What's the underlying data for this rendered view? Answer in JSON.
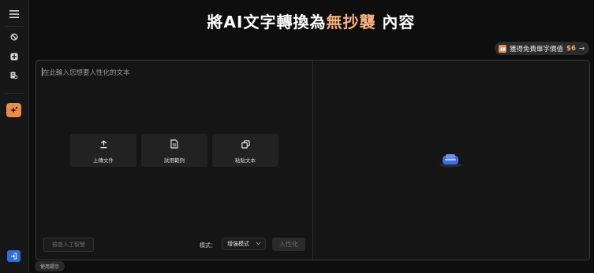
{
  "sidebar": {
    "items": [
      {
        "icon": "menu-icon"
      },
      {
        "icon": "detector-icon"
      },
      {
        "icon": "add-icon"
      },
      {
        "icon": "document-search-icon"
      },
      {
        "icon": "sparkle-icon",
        "active": true
      },
      {
        "icon": "login-icon"
      }
    ]
  },
  "header": {
    "title_prefix": "將AI文字轉換為",
    "title_highlight": "無抄襲",
    "title_suffix": " 內容"
  },
  "promo": {
    "text": "獲得免費單字價值",
    "amount": "$6",
    "arrow": "→"
  },
  "editor": {
    "placeholder": "在此輸入您想要人性化的文本",
    "actions": [
      {
        "label": "上傳文件",
        "icon": "upload-icon"
      },
      {
        "label": "試用範例",
        "icon": "document-icon"
      },
      {
        "label": "粘貼文本",
        "icon": "paste-icon"
      }
    ],
    "check_button": "檢查人工智慧",
    "mode_label": "模式：",
    "mode_value": "增強模式",
    "humanize_button": "人性化"
  },
  "footer": {
    "tips": "使用提示"
  },
  "colors": {
    "accent": "#f4b283",
    "orange": "#e98d4f",
    "blue": "#2f6bdb",
    "illustration": "#3f6fe0"
  }
}
